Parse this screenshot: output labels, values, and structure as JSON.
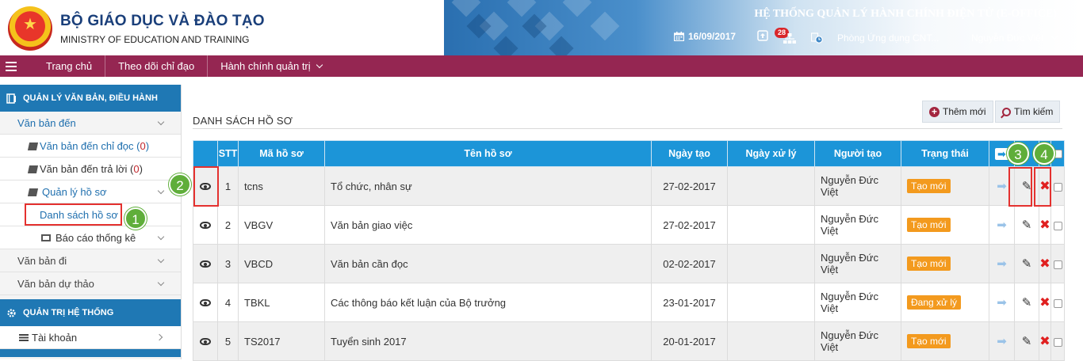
{
  "header": {
    "org_name_vn": "BỘ GIÁO DỤC VÀ ĐÀO TẠO",
    "org_name_en": "MINISTRY OF EDUCATION AND TRAINING",
    "system_title": "HỆ THỐNG QUẢN LÝ HÀNH CHÍNH ĐIỆN TỬ (E-OFFICE)",
    "date": "16/09/2017",
    "notification_count": "28",
    "department": "Phòng Ứng dụng CNT...",
    "user_name": "Nguyễn Đức Việt"
  },
  "nav": {
    "items": [
      "Trang chủ",
      "Theo dõi chỉ đạo",
      "Hành chính quản trị"
    ]
  },
  "sidebar": {
    "section1_title": "QUẢN LÝ VĂN BẢN, ĐIỀU HÀNH",
    "van_ban_den": "Văn bản đến",
    "vbd_chi_doc_label": "Văn bản đến chỉ đọc (",
    "vbd_chi_doc_count": "0",
    "vbd_tra_loi_label": "Văn bản đến trả lời (",
    "vbd_tra_loi_count": "0",
    "close_paren": ")",
    "quan_ly_ho_so": "Quản lý hồ sơ",
    "danh_sach_ho_so": "Danh sách hồ sơ",
    "bao_cao_thong_ke": "Báo cáo thống kê",
    "van_ban_di": "Văn bản đi",
    "van_ban_du_thao": "Văn bản dự thảo",
    "section2_title": "QUẢN TRỊ HỆ THỐNG",
    "tai_khoan": "Tài khoản"
  },
  "main": {
    "title": "DANH SÁCH HỒ SƠ",
    "add_button": "Thêm mới",
    "search_button": "Tìm kiếm",
    "columns": [
      "STT",
      "Mã hồ sơ",
      "Tên hồ sơ",
      "Ngày tạo",
      "Ngày xử lý",
      "Người tạo",
      "Trạng thái"
    ],
    "rows": [
      {
        "stt": "1",
        "ma": "tcns",
        "ten": "Tổ chức, nhân sự",
        "ngay_tao": "27-02-2017",
        "ngay_xu_ly": "",
        "nguoi_tao": "Nguyễn Đức Việt",
        "trang_thai": "Tạo mới"
      },
      {
        "stt": "2",
        "ma": "VBGV",
        "ten": "Văn bản giao việc",
        "ngay_tao": "27-02-2017",
        "ngay_xu_ly": "",
        "nguoi_tao": "Nguyễn Đức Việt",
        "trang_thai": "Tạo mới"
      },
      {
        "stt": "3",
        "ma": "VBCD",
        "ten": "Văn bản cần đọc",
        "ngay_tao": "02-02-2017",
        "ngay_xu_ly": "",
        "nguoi_tao": "Nguyễn Đức Việt",
        "trang_thai": "Tạo mới"
      },
      {
        "stt": "4",
        "ma": "TBKL",
        "ten": "Các thông báo kết luận của Bộ trưởng",
        "ngay_tao": "23-01-2017",
        "ngay_xu_ly": "",
        "nguoi_tao": "Nguyễn Đức Việt",
        "trang_thai": "Đang xử lý"
      },
      {
        "stt": "5",
        "ma": "TS2017",
        "ten": "Tuyển sinh 2017",
        "ngay_tao": "20-01-2017",
        "ngay_xu_ly": "",
        "nguoi_tao": "Nguyễn Đức Việt",
        "trang_thai": "Tạo mới"
      }
    ]
  },
  "annotations": {
    "m1": "1",
    "m2": "2",
    "m3": "3",
    "m4": "4"
  },
  "colors": {
    "nav_bg": "#952652",
    "sidebar_section_bg": "#1f78b4",
    "table_header_bg": "#1c95d8",
    "status_orange": "#f39a1e",
    "marker_green": "#5fae3a",
    "highlight_red": "#e4312f"
  },
  "icons": [
    "menu-icon",
    "calendar-icon",
    "inbox-icon",
    "org-chart-icon",
    "clock-icon",
    "view-icon",
    "forward-arrow-icon",
    "edit-icon",
    "delete-icon",
    "plus-icon",
    "search-icon"
  ]
}
